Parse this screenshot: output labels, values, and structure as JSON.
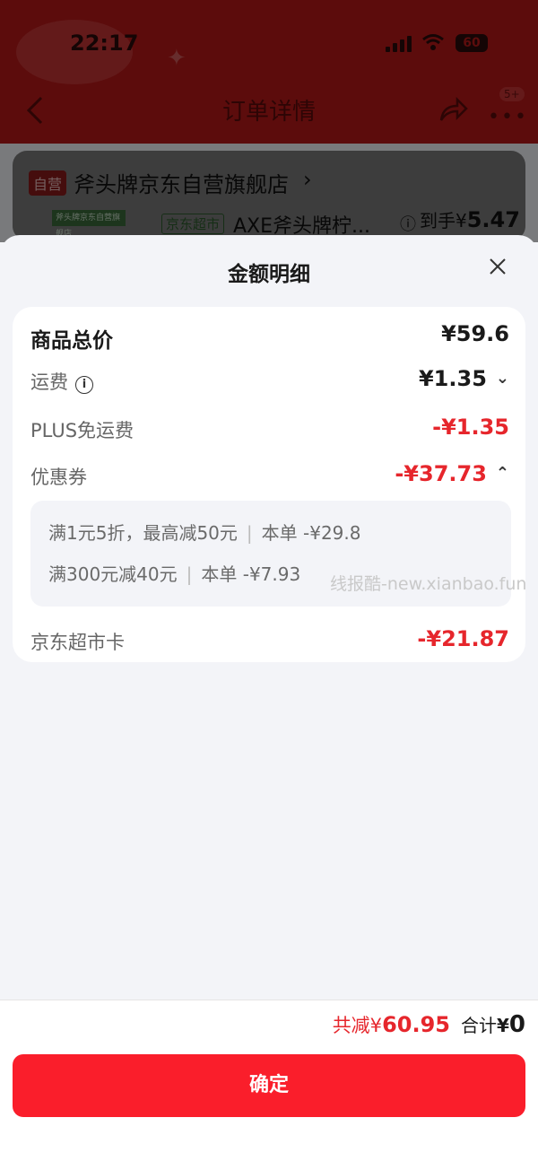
{
  "status_bar": {
    "time": "22:17",
    "battery": "60"
  },
  "nav": {
    "title": "订单详情",
    "badge": "5+"
  },
  "background_order": {
    "store_tag": "自营",
    "store_name": "斧头牌京东自营旗舰店",
    "product_image_text": "斧头牌京东自营旗舰店",
    "channel_tag": "京东超市",
    "product_name": "AXE斧头牌柠...",
    "price_prefix": "到手¥",
    "price_value": "5.47"
  },
  "sheet": {
    "title": "金额明细",
    "rows": {
      "goods_total": {
        "label": "商品总价",
        "value": "¥59.6"
      },
      "shipping": {
        "label": "运费",
        "value": "¥1.35"
      },
      "plus_free_shipping": {
        "label": "PLUS免运费",
        "value": "-¥1.35"
      },
      "coupon": {
        "label": "优惠券",
        "value": "-¥37.73"
      },
      "supermarket_card": {
        "label": "京东超市卡",
        "value": "-¥21.87"
      }
    },
    "coupon_details": [
      {
        "desc": "满1元5折，最高减50元",
        "sep": "|",
        "amount": "本单 -¥29.8"
      },
      {
        "desc": "满300元减40元",
        "sep": "|",
        "amount": "本单 -¥7.93"
      }
    ],
    "watermark": "线报酷-new.xianbao.fun"
  },
  "footer": {
    "saved_label": "共减¥",
    "saved_value": "60.95",
    "total_label": "合计",
    "total_currency": "¥",
    "total_value": "0",
    "confirm_label": "确定"
  },
  "colors": {
    "accent_red": "#fa1e2b",
    "discount_red": "#e6262c",
    "header_red": "#b81818"
  }
}
